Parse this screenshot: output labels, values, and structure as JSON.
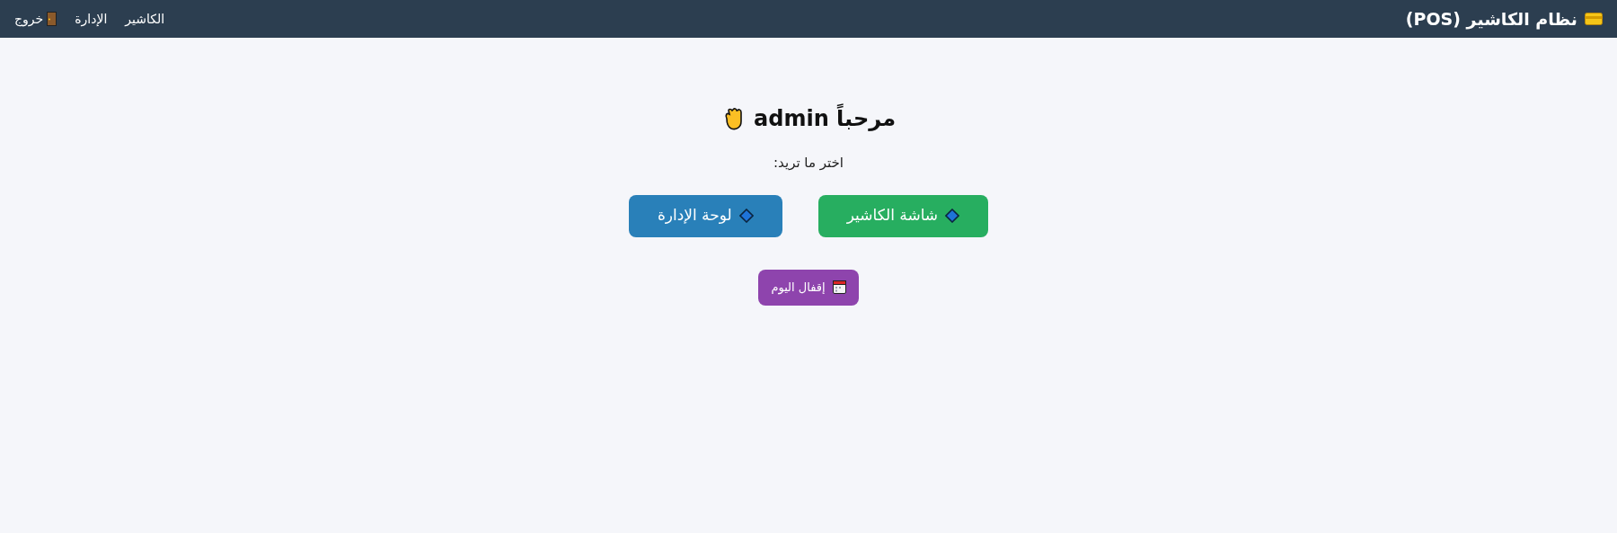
{
  "header": {
    "title": "نظام الكاشير (POS)",
    "nav": [
      {
        "label": "الكاشير",
        "kind": "link"
      },
      {
        "label": "الإدارة",
        "kind": "link"
      },
      {
        "label": "خروج",
        "kind": "logout"
      }
    ]
  },
  "greeting": {
    "text": "مرحباً admin"
  },
  "prompt": "اختر ما تريد:",
  "main_buttons": [
    {
      "label": "شاشة الكاشير",
      "color": "#27ae60"
    },
    {
      "label": "لوحة الإدارة",
      "color": "#2980b9"
    }
  ],
  "close_day_button": {
    "label": "إقفال اليوم",
    "color": "#8e44ad"
  }
}
